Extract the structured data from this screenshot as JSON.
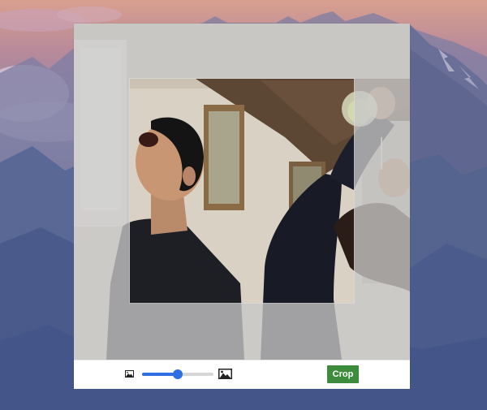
{
  "desktop": {
    "wallpaper": "mountains-dusk"
  },
  "cropper": {
    "zoom_out_icon": "image-small-icon",
    "zoom_in_icon": "image-large-icon",
    "zoom_level": 0.5,
    "crop_button_label": "Crop",
    "colors": {
      "accent": "#2f6fe4",
      "crop_button": "#3d8b3d",
      "mask": "#c8c8c8"
    }
  }
}
